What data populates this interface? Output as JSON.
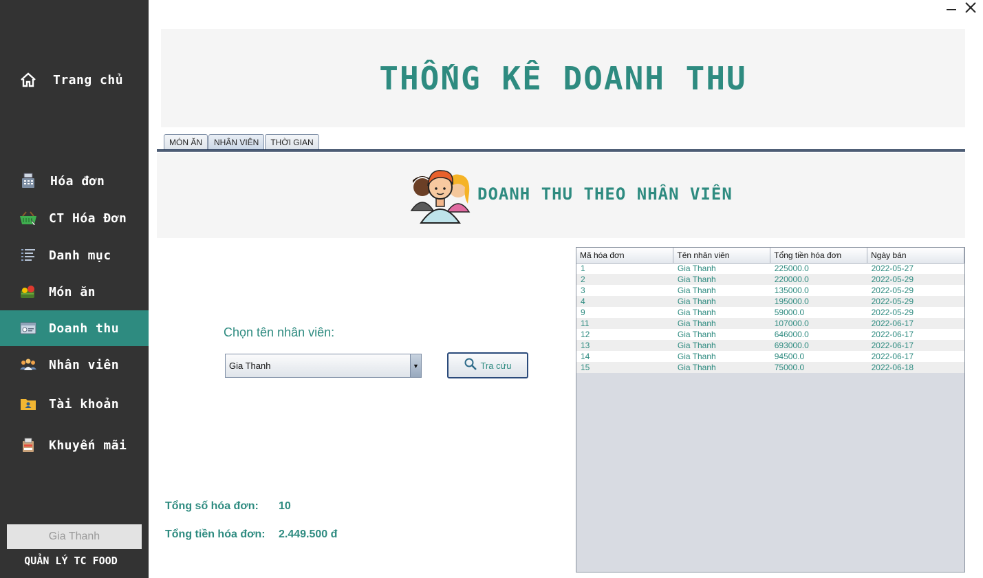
{
  "window": {
    "minimize_icon": "minimize-icon",
    "close_icon": "close-icon"
  },
  "sidebar": {
    "items": [
      {
        "label": "Trang chủ",
        "icon": "home-icon"
      },
      {
        "label": "Hóa đơn",
        "icon": "cash-register-icon"
      },
      {
        "label": "CT Hóa Đơn",
        "icon": "basket-icon"
      },
      {
        "label": "Danh mục",
        "icon": "list-icon"
      },
      {
        "label": "Món ăn",
        "icon": "food-icon"
      },
      {
        "label": "Doanh thu",
        "icon": "revenue-icon",
        "active": true
      },
      {
        "label": "Nhân viên",
        "icon": "people-icon"
      },
      {
        "label": "Tài khoản",
        "icon": "account-folder-icon"
      },
      {
        "label": "Khuyến mãi",
        "icon": "promotion-icon"
      }
    ],
    "user": "Gia Thanh",
    "app_name": "QUẢN LÝ TC FOOD",
    "active_color": "#2e8b80"
  },
  "header": {
    "title": "THỐNG KÊ DOANH THU"
  },
  "tabs": [
    {
      "label": "MÓN ĂN"
    },
    {
      "label": "NHÂN VIÊN",
      "active": true
    },
    {
      "label": "THỜI GIAN"
    }
  ],
  "section": {
    "title": "DOANH THU THEO NHÂN VIÊN",
    "icon": "employees-group-icon"
  },
  "filter": {
    "label": "Chọn tên nhân viên:",
    "selected": "Gia Thanh",
    "button_label": "Tra cứu",
    "button_icon": "search-icon"
  },
  "summary": {
    "count_label": "Tổng số hóa đơn:",
    "count_value": "10",
    "total_label": "Tổng tiền hóa đơn:",
    "total_value": "2.449.500 đ"
  },
  "table": {
    "columns": [
      "Mã hóa đơn",
      "Tên nhân viên",
      "Tổng tiền hóa đơn",
      "Ngày bán"
    ],
    "rows": [
      [
        "1",
        "Gia Thanh",
        "225000.0",
        "2022-05-27"
      ],
      [
        "2",
        "Gia Thanh",
        "220000.0",
        "2022-05-29"
      ],
      [
        "3",
        "Gia Thanh",
        "135000.0",
        "2022-05-29"
      ],
      [
        "4",
        "Gia Thanh",
        "195000.0",
        "2022-05-29"
      ],
      [
        "9",
        "Gia Thanh",
        "59000.0",
        "2022-05-29"
      ],
      [
        "11",
        "Gia Thanh",
        "107000.0",
        "2022-06-17"
      ],
      [
        "12",
        "Gia Thanh",
        "646000.0",
        "2022-06-17"
      ],
      [
        "13",
        "Gia Thanh",
        "693000.0",
        "2022-06-17"
      ],
      [
        "14",
        "Gia Thanh",
        "94500.0",
        "2022-06-17"
      ],
      [
        "15",
        "Gia Thanh",
        "75000.0",
        "2022-06-18"
      ]
    ]
  },
  "colors": {
    "accent": "#2e8b80",
    "sidebar": "#333333"
  }
}
